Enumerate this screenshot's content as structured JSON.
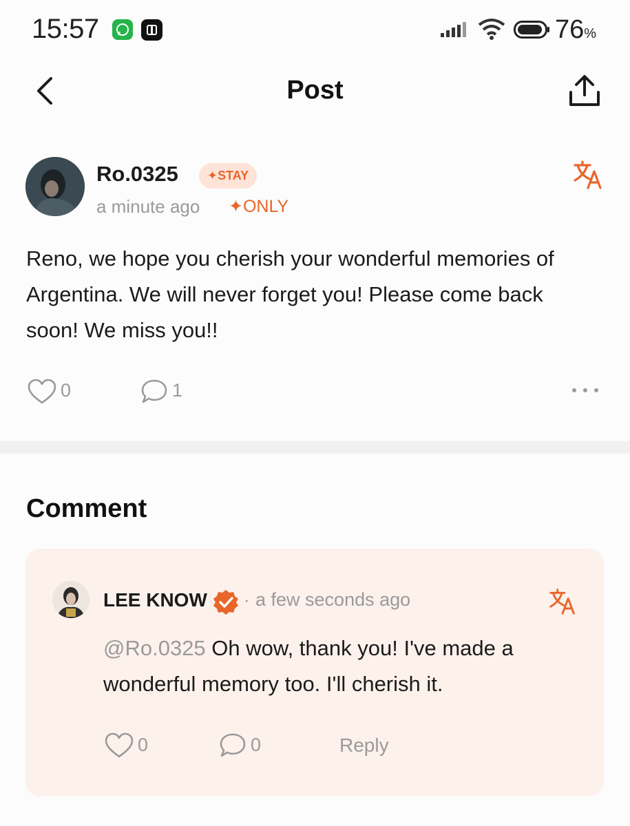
{
  "status_bar": {
    "time": "15:57",
    "battery": "76",
    "battery_unit": "%",
    "icons": [
      "whatsapp-icon",
      "app-icon",
      "signal-icon",
      "wifi-icon",
      "battery-icon"
    ]
  },
  "header": {
    "title": "Post",
    "back_icon": "chevron-left-icon",
    "share_icon": "share-icon"
  },
  "post": {
    "author": "Ro.0325",
    "badge": "✦STAY",
    "time": "a minute ago",
    "visibility": "✦ONLY",
    "body": "Reno, we hope you cherish your wonderful memories of Argentina. We will never forget you! Please come back soon! We miss you!!",
    "likes": "0",
    "comments": "1"
  },
  "comments_section": {
    "heading": "Comment",
    "items": [
      {
        "author": "LEE KNOW",
        "separator": "·",
        "time": "a few seconds ago",
        "mention": "@Ro.0325",
        "text": " Oh wow, thank you! I've made a wonderful memory too. I'll cherish it.",
        "likes": "0",
        "replies": "0",
        "reply_label": "Reply"
      }
    ]
  },
  "colors": {
    "accent": "#e8662a",
    "badge_bg": "#fde3d8",
    "card_bg": "#fdf1ec",
    "muted_text": "#9a9a9a"
  }
}
